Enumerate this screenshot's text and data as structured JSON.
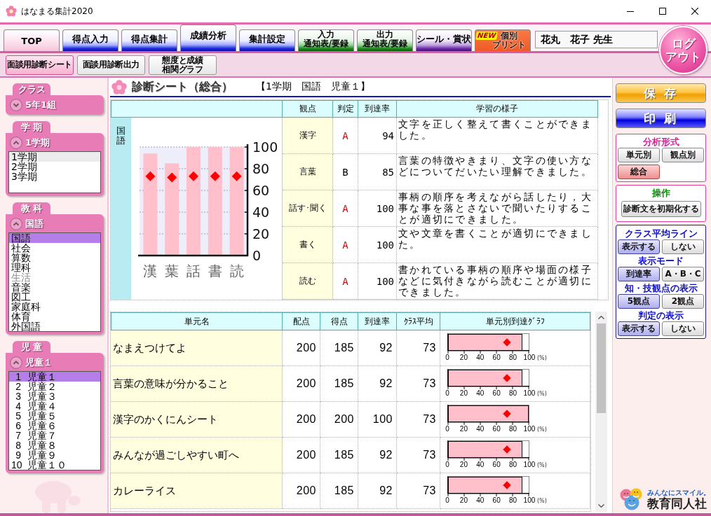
{
  "window": {
    "title": "はなまる集計2020"
  },
  "tabs": [
    {
      "lines": [
        "TOP"
      ],
      "kind": "top",
      "selected": false
    },
    {
      "lines": [
        "得点入力"
      ],
      "kind": "blue",
      "selected": false
    },
    {
      "lines": [
        "得点集計"
      ],
      "kind": "blue",
      "selected": false
    },
    {
      "lines": [
        "成績分析"
      ],
      "kind": "blue",
      "selected": true
    },
    {
      "lines": [
        "集計設定"
      ],
      "kind": "blue",
      "selected": false
    },
    {
      "lines": [
        "入力",
        "通知表/要録"
      ],
      "kind": "green",
      "selected": false
    },
    {
      "lines": [
        "出力",
        "通知表/要録"
      ],
      "kind": "green",
      "selected": false
    },
    {
      "lines": [
        "シール・賞状"
      ],
      "kind": "purple",
      "selected": false
    },
    {
      "lines": [
        "個別",
        "プリント"
      ],
      "kind": "orange",
      "badge": "NEW",
      "selected": false
    }
  ],
  "teacher": {
    "value": "花丸　花子 先生"
  },
  "logout_button": {
    "lines": [
      "ログ",
      "アウト"
    ]
  },
  "subtabs": [
    {
      "lines": [
        "面談用診断シート"
      ],
      "selected": true
    },
    {
      "lines": [
        "面談用診断出力"
      ],
      "selected": false
    },
    {
      "lines": [
        "態度と成績",
        "相関グラフ"
      ],
      "selected": false
    }
  ],
  "sidebar": [
    {
      "title": "クラス",
      "value": "5年1組",
      "expanded": false
    },
    {
      "title": "学 期",
      "value": "1学期",
      "expanded": true,
      "focused": false,
      "items": [
        {
          "label": "1学期",
          "selected": true
        },
        {
          "label": "2学期",
          "selected": false
        },
        {
          "label": "3学期",
          "selected": false
        }
      ]
    },
    {
      "title": "教 科",
      "value": "国語",
      "expanded": true,
      "focused": true,
      "items": [
        {
          "label": "国語",
          "selected": true,
          "disabled": false
        },
        {
          "label": "社会",
          "selected": false,
          "disabled": false
        },
        {
          "label": "算数",
          "selected": false,
          "disabled": false
        },
        {
          "label": "理科",
          "selected": false,
          "disabled": false
        },
        {
          "label": "生活",
          "selected": false,
          "disabled": true
        },
        {
          "label": "音楽",
          "selected": false,
          "disabled": false
        },
        {
          "label": "図工",
          "selected": false,
          "disabled": false
        },
        {
          "label": "家庭科",
          "selected": false,
          "disabled": false
        },
        {
          "label": "体育",
          "selected": false,
          "disabled": false
        },
        {
          "label": "外国語",
          "selected": false,
          "disabled": false
        }
      ]
    },
    {
      "title": "児 童",
      "value": "児童１",
      "expanded": true,
      "focused": true,
      "items": [
        {
          "number": "1",
          "label": "児童１",
          "selected": true
        },
        {
          "number": "2",
          "label": "児童２",
          "selected": false
        },
        {
          "number": "3",
          "label": "児童３",
          "selected": false
        },
        {
          "number": "4",
          "label": "児童４",
          "selected": false
        },
        {
          "number": "5",
          "label": "児童５",
          "selected": false
        },
        {
          "number": "6",
          "label": "児童６",
          "selected": false
        },
        {
          "number": "7",
          "label": "児童７",
          "selected": false
        },
        {
          "number": "8",
          "label": "児童８",
          "selected": false
        },
        {
          "number": "9",
          "label": "児童９",
          "selected": false
        },
        {
          "number": "10",
          "label": "児童１０",
          "selected": false
        }
      ]
    }
  ],
  "sheet": {
    "title": "診断シート（総合）",
    "context": "【1学期　国語　児童１】",
    "aspect_table": {
      "columns": [
        "観点",
        "判定",
        "到達率",
        "学習の様子"
      ],
      "subject": "国語",
      "chart_data": {
        "type": "bar",
        "categories": [
          "漢",
          "葉",
          "話",
          "書",
          "読"
        ],
        "series": [
          {
            "color": "#ffc0cb",
            "values": [
              94,
              85,
              100,
              100,
              100
            ]
          },
          {
            "type": "scatter",
            "color": "#ff0000",
            "values": [
              73,
              72,
              73,
              73,
              73
            ]
          }
        ],
        "ylim": [
          0,
          100
        ],
        "yticks": [
          0,
          20,
          40,
          60,
          80,
          100
        ],
        "grid": true
      },
      "rows": [
        {
          "aspect": "漢字",
          "grade": {
            "text": "A",
            "color": "#d80000"
          },
          "rate": "94",
          "comment": "文字を正しく整えて書くことができました。"
        },
        {
          "aspect": "言葉",
          "grade": {
            "text": "B",
            "color": "#000000"
          },
          "rate": "85",
          "comment": "言葉の特徴やきまり、文字の使い方などについてだいたい理解できました。"
        },
        {
          "aspect": "話す･聞く",
          "grade": {
            "text": "A",
            "color": "#d80000"
          },
          "rate": "100",
          "comment": "事柄の順序を考えながら話したり，大事な事を落とさないで聞いたりすることが適切にできました。"
        },
        {
          "aspect": "書く",
          "grade": {
            "text": "A",
            "color": "#d80000"
          },
          "rate": "100",
          "comment": "文や文章を書くことが適切にできました。"
        },
        {
          "aspect": "読む",
          "grade": {
            "text": "A",
            "color": "#d80000"
          },
          "rate": "100",
          "comment": "書かれている事柄の順序や場面の様子などに気付きながら読むことが適切にできました。"
        }
      ]
    },
    "unit_table": {
      "columns": [
        "単元名",
        "配点",
        "得点",
        "到達率",
        "ｸﾗｽ平均",
        "単元別到達ｸﾞﾗﾌ"
      ],
      "rows": [
        {
          "name": "なまえつけてよ",
          "points": "200",
          "score": "185",
          "rate": "92",
          "class_average": "73",
          "graph": {
            "level": 0.92,
            "marker": {
              "level": 0.73
            },
            "scale": [
              "0",
              "20",
              "40",
              "60",
              "80",
              "100"
            ],
            "unit": "(%)"
          }
        },
        {
          "name": "言葉の意味が分かること",
          "points": "200",
          "score": "185",
          "rate": "92",
          "class_average": "73",
          "graph": {
            "level": 0.92,
            "marker": {
              "level": 0.73
            },
            "scale": [
              "0",
              "20",
              "40",
              "60",
              "80",
              "100"
            ],
            "unit": "(%)"
          }
        },
        {
          "name": "漢字のかくにんシート",
          "points": "200",
          "score": "200",
          "rate": "100",
          "class_average": "73",
          "graph": {
            "level": 1,
            "marker": {
              "level": 0.73
            },
            "scale": [
              "0",
              "20",
              "40",
              "60",
              "80",
              "100"
            ],
            "unit": "(%)"
          }
        },
        {
          "name": "みんなが過ごしやすい町へ",
          "points": "200",
          "score": "185",
          "rate": "92",
          "class_average": "73",
          "graph": {
            "level": 0.92,
            "marker": {
              "level": 0.73
            },
            "scale": [
              "0",
              "20",
              "40",
              "60",
              "80",
              "100"
            ],
            "unit": "(%)"
          }
        },
        {
          "name": "カレーライス",
          "points": "200",
          "score": "185",
          "rate": "92",
          "class_average": "73",
          "graph": {
            "level": 0.92,
            "marker": {
              "level": 0.73
            },
            "scale": [
              "0",
              "20",
              "40",
              "60",
              "80",
              "100"
            ],
            "unit": "(%)"
          }
        }
      ]
    }
  },
  "right_panel": {
    "buttons": [
      {
        "label": "保 存",
        "kind": "save"
      },
      {
        "label": "印 刷",
        "kind": "print"
      }
    ],
    "analysis": {
      "title": "分析形式",
      "options": [
        {
          "label": "単元別",
          "selected": false
        },
        {
          "label": "観点別",
          "selected": false
        },
        {
          "label": "総合",
          "selected": true
        }
      ]
    },
    "operation": {
      "title": "操作",
      "button": "診断文を初期化する"
    },
    "display": [
      {
        "title": "クラス平均ライン",
        "options": [
          {
            "label": "表示する",
            "selected": true
          },
          {
            "label": "しない",
            "selected": false
          }
        ]
      },
      {
        "title": "表示モード",
        "options": [
          {
            "label": "到達率",
            "selected": true
          },
          {
            "label": "A・B・C",
            "selected": false
          }
        ]
      },
      {
        "title": "知・技観点の表示",
        "options": [
          {
            "label": "5観点",
            "selected": true
          },
          {
            "label": "2観点",
            "selected": false
          }
        ]
      },
      {
        "title": "判定の表示",
        "options": [
          {
            "label": "表示する",
            "selected": true
          },
          {
            "label": "しない",
            "selected": false
          }
        ]
      }
    ]
  },
  "logo": {
    "tagline": "みんなにスマイル。",
    "name": "教育同人社"
  }
}
